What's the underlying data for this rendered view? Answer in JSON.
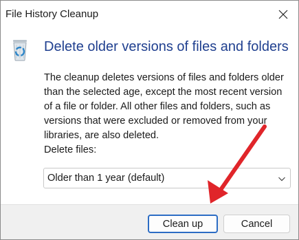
{
  "window": {
    "title": "File History Cleanup",
    "close_label": "×"
  },
  "content": {
    "icon": "recycle-bin-icon",
    "heading": "Delete older versions of files and folders",
    "description": "The cleanup deletes versions of files and folders older than the selected age, except the most recent version of a file or folder. All other files and folders, such as versions that were excluded or removed from your libraries, are also deleted.",
    "delete_files_label": "Delete files:",
    "age_select": {
      "selected": "Older than 1 year (default)"
    }
  },
  "footer": {
    "clean_up_label": "Clean up",
    "cancel_label": "Cancel"
  },
  "colors": {
    "heading": "#1f3f8f",
    "primary_border": "#2b6cc4",
    "annotation_arrow": "#e0252a"
  }
}
